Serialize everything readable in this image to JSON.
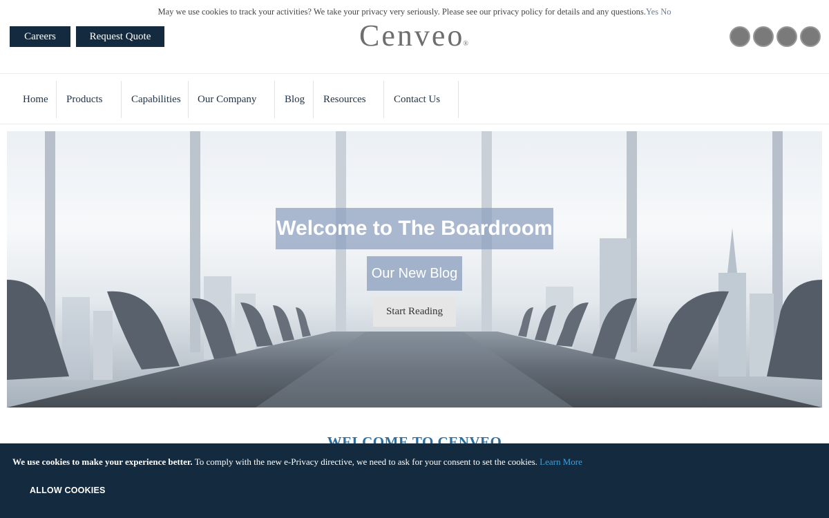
{
  "privacy_notice": {
    "text": "May we use cookies to track your activities? We take your privacy very seriously. Please see our privacy policy for details and any questions.",
    "yes_label": "Yes",
    "no_label": "No"
  },
  "header": {
    "careers_label": "Careers",
    "request_quote_label": "Request Quote",
    "logo_text": "Cenveo",
    "logo_mark": "®",
    "social_icons": [
      "social-icon-1",
      "social-icon-2",
      "social-icon-3",
      "social-icon-4"
    ]
  },
  "nav": {
    "items": [
      {
        "label": "Home"
      },
      {
        "label": "Products"
      },
      {
        "label": "Capabilities"
      },
      {
        "label": "Our Company"
      },
      {
        "label": "Blog"
      },
      {
        "label": "Resources"
      },
      {
        "label": "Contact Us"
      }
    ]
  },
  "hero": {
    "title": "Welcome to The Boardroom",
    "subtitle": "Our New Blog",
    "cta_label": "Start Reading"
  },
  "section": {
    "heading": "WELCOME TO CENVEO"
  },
  "cookie_banner": {
    "bold_text": "We use cookies to make your experience better.",
    "text": " To comply with the new e-Privacy directive, we need to ask for your consent to set the cookies. ",
    "learn_more_label": "Learn More",
    "allow_label": "ALLOW COOKIES"
  },
  "colors": {
    "navy": "#142a3e",
    "link_blue": "#3aa0e0",
    "heading_blue": "#2a6fa3"
  }
}
